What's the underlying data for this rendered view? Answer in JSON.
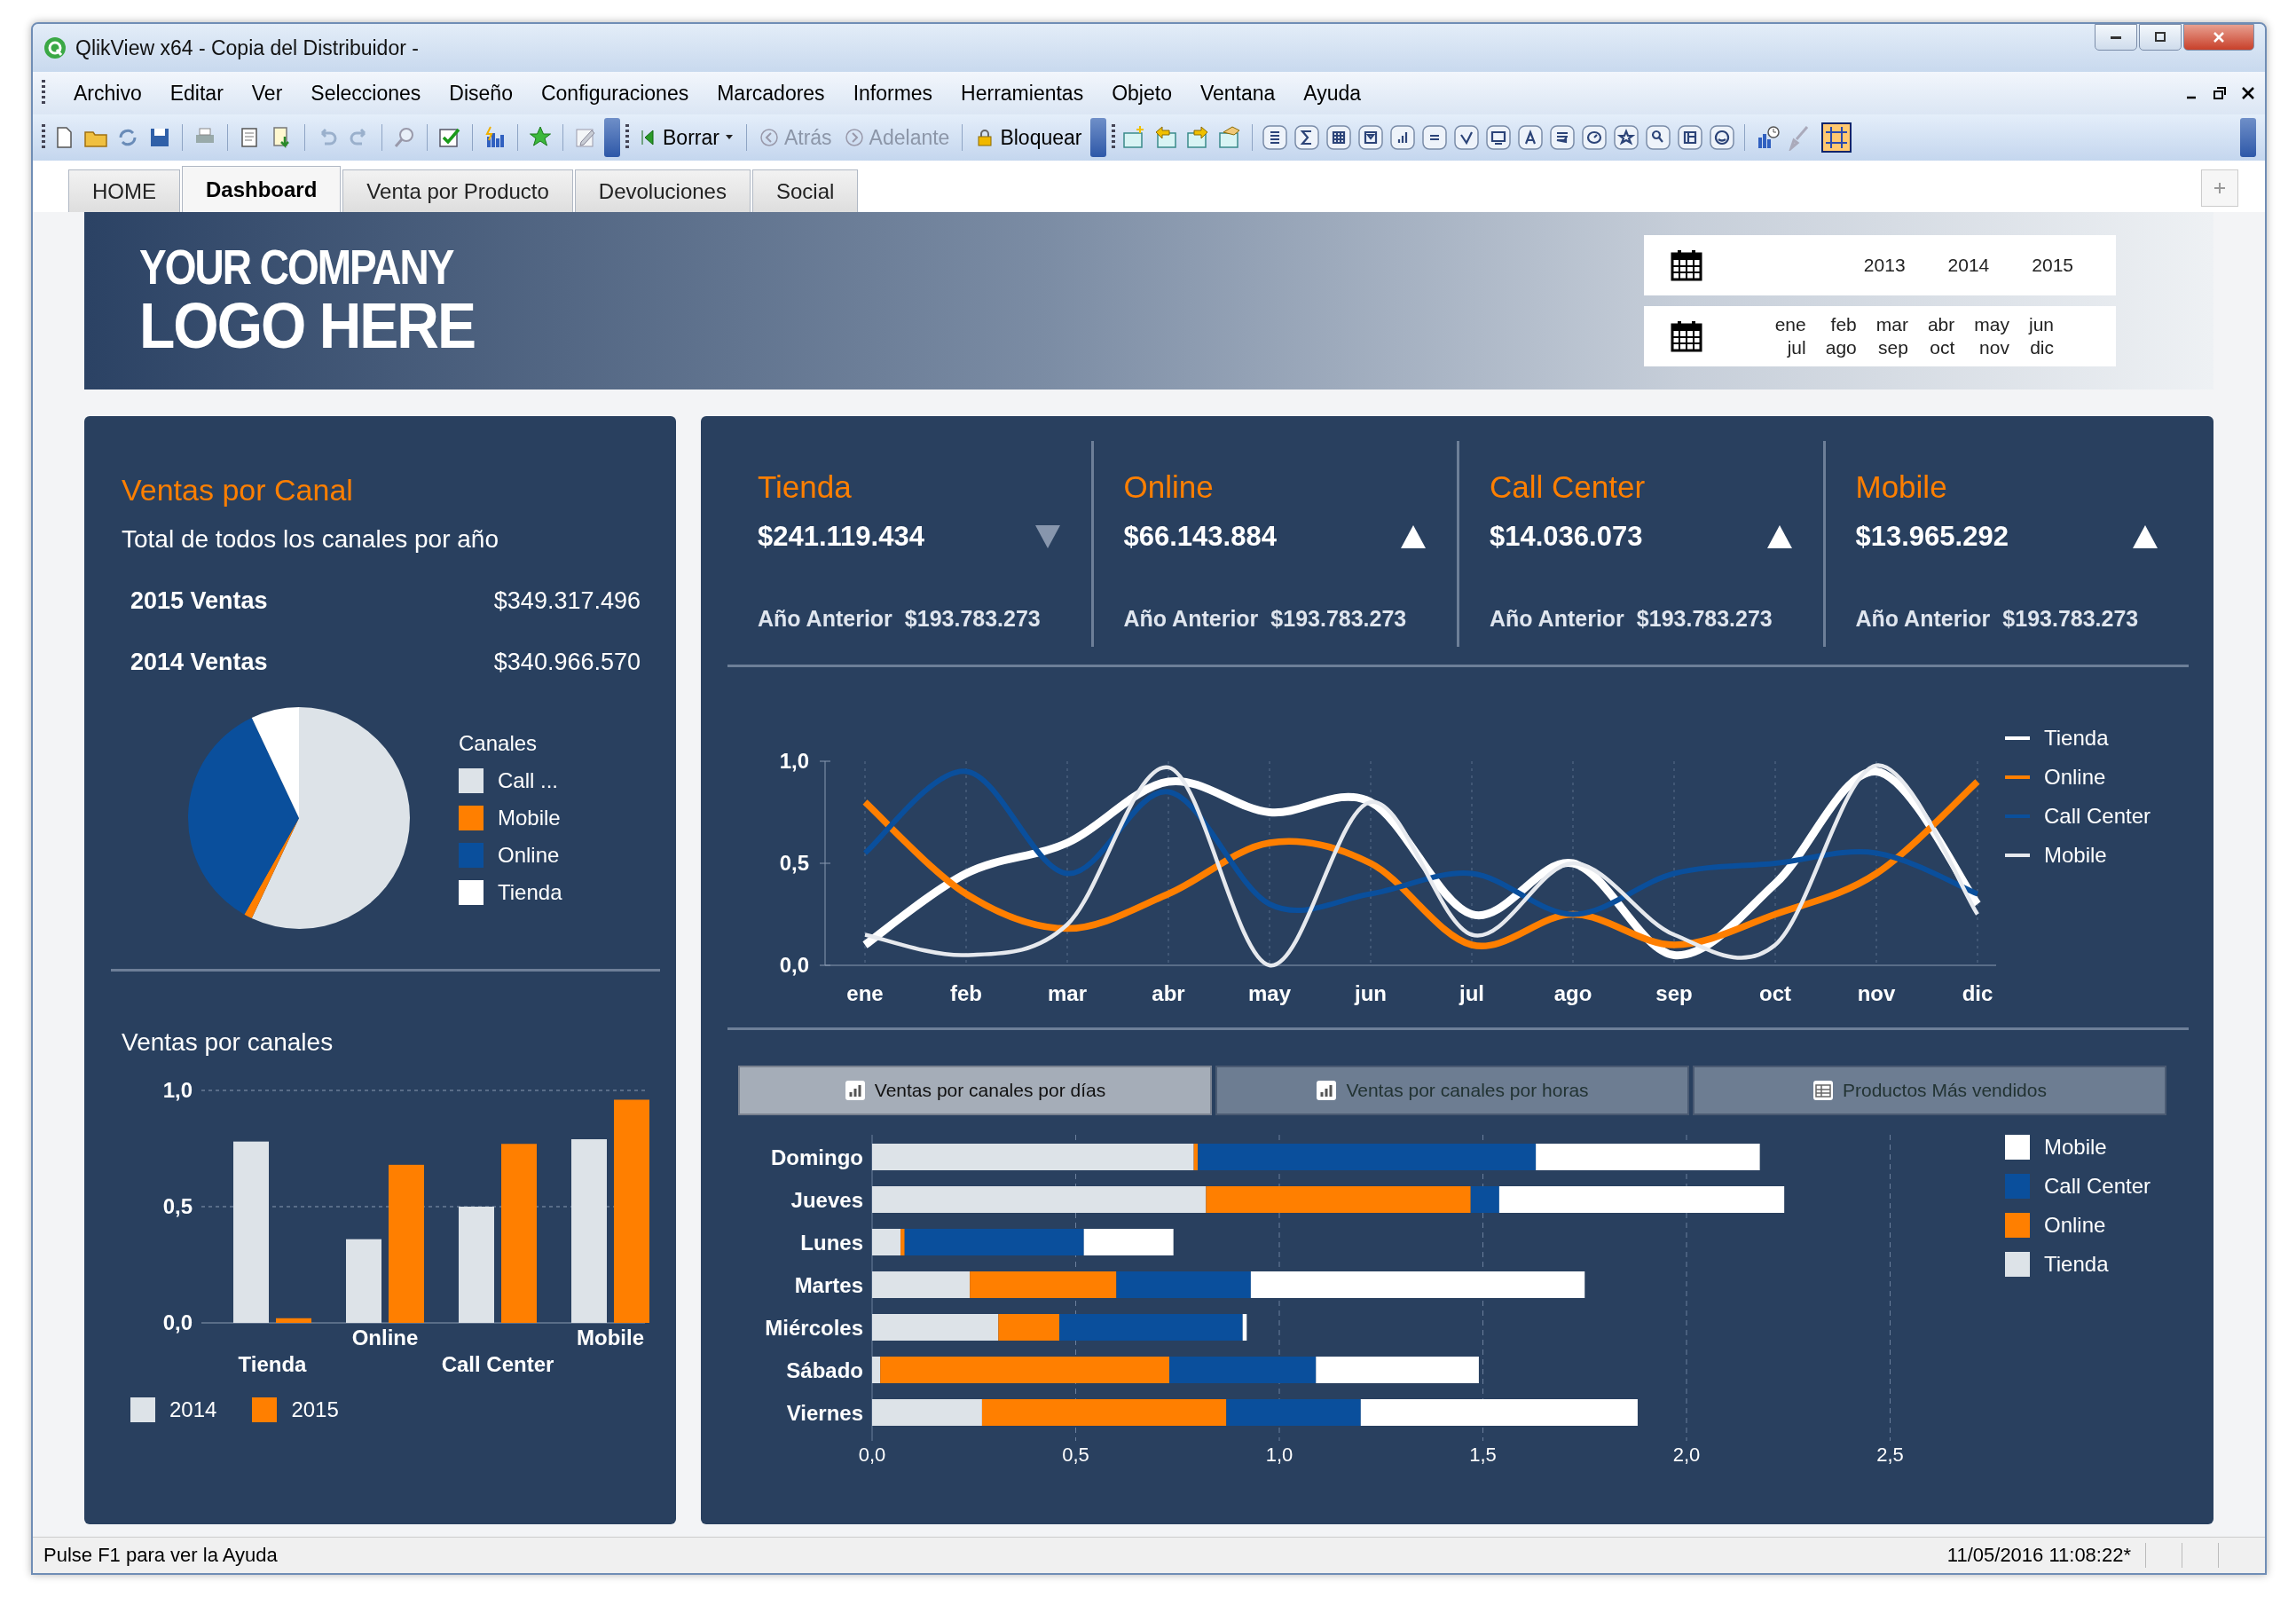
{
  "window": {
    "title": "QlikView x64 - Copia del Distribuidor -"
  },
  "menu": [
    "Archivo",
    "Editar",
    "Ver",
    "Selecciones",
    "Diseño",
    "Configuraciones",
    "Marcadores",
    "Informes",
    "Herramientas",
    "Objeto",
    "Ventana",
    "Ayuda"
  ],
  "toolbar": {
    "buttons": [
      {
        "label": "Borrar",
        "kind": "dropdown",
        "disabled": false
      },
      {
        "label": "Atrás",
        "kind": "back",
        "disabled": true
      },
      {
        "label": "Adelante",
        "kind": "forward",
        "disabled": true
      },
      {
        "label": "Bloquear",
        "kind": "lock",
        "disabled": false
      }
    ]
  },
  "tabs": [
    {
      "label": "HOME",
      "selected": false
    },
    {
      "label": "Dashboard",
      "selected": true
    },
    {
      "label": "Venta por Producto",
      "selected": false
    },
    {
      "label": "Devoluciones",
      "selected": false
    },
    {
      "label": "Social",
      "selected": false
    }
  ],
  "banner": {
    "logo": [
      "YOUR COMPANY",
      "LOGO HERE"
    ]
  },
  "calendar": {
    "years": [
      "2013",
      "2014",
      "2015"
    ],
    "months": [
      "ene",
      "feb",
      "mar",
      "abr",
      "may",
      "jun",
      "jul",
      "ago",
      "sep",
      "oct",
      "nov",
      "dic"
    ]
  },
  "channel_panel": {
    "title": "Ventas por Canal",
    "subtitle": "Total de todos los canales por año",
    "totals": [
      {
        "label": "2015 Ventas",
        "value": "$349.317.496"
      },
      {
        "label": "2014 Ventas",
        "value": "$340.966.570"
      }
    ],
    "legend": {
      "title": "Canales",
      "items": [
        {
          "label": "Call ...",
          "color": "#dde3e8"
        },
        {
          "label": "Mobile",
          "color": "#ff7f00"
        },
        {
          "label": "Online",
          "color": "#0a4f9c"
        },
        {
          "label": "Tienda",
          "color": "#ffffff"
        }
      ]
    }
  },
  "bar_panel": {
    "title": "Ventas por canales",
    "chart_data": {
      "type": "bar",
      "categories": [
        "Tienda",
        "Online",
        "Call Center",
        "Mobile"
      ],
      "yticks": [
        {
          "value": 0,
          "label": "0,0"
        },
        {
          "value": 0.5,
          "label": "0,5"
        },
        {
          "value": 1,
          "label": "1,0"
        }
      ],
      "ylim": [
        0,
        1
      ],
      "series": [
        {
          "name": "2014",
          "color": "#dde3e8",
          "values": [
            0.78,
            0.36,
            0.5,
            0.79
          ]
        },
        {
          "name": "2015",
          "color": "#ff7f00",
          "values": [
            0.02,
            0.68,
            0.77,
            0.96
          ]
        }
      ]
    }
  },
  "kpis": [
    {
      "title": "Tienda",
      "value": "$241.119.434",
      "rising": false,
      "prev_label": "Año Anterior",
      "prev_value": "$193.783.273"
    },
    {
      "title": "Online",
      "value": "$66.143.884",
      "rising": true,
      "prev_label": "Año Anterior",
      "prev_value": "$193.783.273"
    },
    {
      "title": "Call Center",
      "value": "$14.036.073",
      "rising": true,
      "prev_label": "Año Anterior",
      "prev_value": "$193.783.273"
    },
    {
      "title": "Mobile",
      "value": "$13.965.292",
      "rising": true,
      "prev_label": "Año Anterior",
      "prev_value": "$193.783.273"
    }
  ],
  "line_chart": {
    "chart_data": {
      "type": "line",
      "grid": true,
      "categories": [
        "ene",
        "feb",
        "mar",
        "abr",
        "may",
        "jun",
        "jul",
        "ago",
        "sep",
        "oct",
        "nov",
        "dic"
      ],
      "yticks": [
        {
          "value": 0,
          "label": "0,0"
        },
        {
          "value": 0.5,
          "label": "0,5"
        },
        {
          "value": 1,
          "label": "1,0"
        }
      ],
      "ylim": [
        0,
        1
      ],
      "series": [
        {
          "name": "Tienda",
          "color": "#ffffff",
          "values": [
            0.1,
            0.45,
            0.6,
            0.9,
            0.75,
            0.8,
            0.25,
            0.5,
            0.05,
            0.4,
            0.95,
            0.3
          ]
        },
        {
          "name": "Online",
          "color": "#ff7f00",
          "values": [
            0.8,
            0.35,
            0.18,
            0.35,
            0.6,
            0.5,
            0.1,
            0.25,
            0.1,
            0.25,
            0.45,
            0.9
          ]
        },
        {
          "name": "Call Center",
          "color": "#0a4f9c",
          "values": [
            0.55,
            0.95,
            0.45,
            0.85,
            0.3,
            0.35,
            0.45,
            0.25,
            0.45,
            0.5,
            0.55,
            0.35
          ]
        },
        {
          "name": "Mobile",
          "color": "#e6e9ee",
          "values": [
            0.15,
            0.05,
            0.2,
            0.97,
            0.0,
            0.8,
            0.15,
            0.5,
            0.15,
            0.1,
            0.98,
            0.25
          ]
        }
      ]
    }
  },
  "detail_tabs": [
    {
      "label": "Ventas por canales por días",
      "selected": true
    },
    {
      "label": "Ventas por canales por horas",
      "selected": false
    },
    {
      "label": "Productos Más vendidos",
      "selected": false
    }
  ],
  "hbar_chart": {
    "chart_data": {
      "type": "bar",
      "grid": true,
      "orientation": "horizontal",
      "stacked": true,
      "categories": [
        "Domingo",
        "Jueves",
        "Lunes",
        "Martes",
        "Miércoles",
        "Sábado",
        "Viernes"
      ],
      "xticks": [
        {
          "value": 0,
          "label": "0,0"
        },
        {
          "value": 0.5,
          "label": "0,5"
        },
        {
          "value": 1,
          "label": "1,0"
        },
        {
          "value": 1.5,
          "label": "1,5"
        },
        {
          "value": 2,
          "label": "2,0"
        },
        {
          "value": 2.5,
          "label": "2,5"
        }
      ],
      "xlim": [
        0,
        2.5
      ],
      "series": [
        {
          "name": "Tienda",
          "color": "#dde3e8",
          "values": [
            0.79,
            0.82,
            0.07,
            0.24,
            0.31,
            0.02,
            0.27
          ]
        },
        {
          "name": "Online",
          "color": "#ff7f00",
          "values": [
            0.01,
            0.65,
            0.01,
            0.36,
            0.15,
            0.71,
            0.6
          ]
        },
        {
          "name": "Call Center",
          "color": "#0a4f9c",
          "values": [
            0.83,
            0.07,
            0.44,
            0.33,
            0.45,
            0.36,
            0.33
          ]
        },
        {
          "name": "Mobile",
          "color": "#ffffff",
          "values": [
            0.55,
            0.7,
            0.22,
            0.82,
            0.01,
            0.4,
            0.68
          ]
        }
      ]
    }
  },
  "status_bar": {
    "help": "Pulse F1 para ver la Ayuda",
    "timestamp": "11/05/2016 11:08:22*"
  }
}
